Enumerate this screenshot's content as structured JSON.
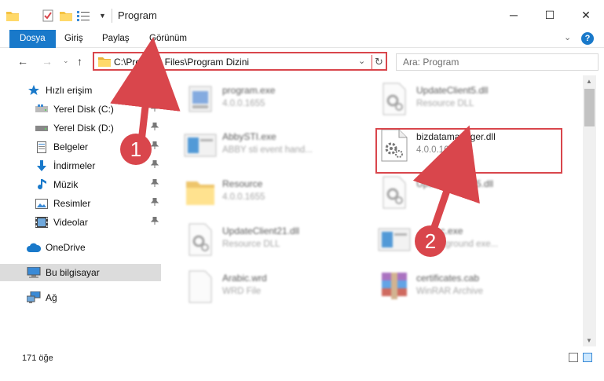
{
  "window": {
    "title": "Program",
    "minimize_glyph": "─",
    "maximize_glyph": "☐",
    "close_glyph": "✕"
  },
  "ribbon": {
    "tabs": [
      {
        "label": "Dosya"
      },
      {
        "label": "Giriş"
      },
      {
        "label": "Paylaş"
      },
      {
        "label": "Görünüm"
      }
    ],
    "help_glyph": "?",
    "collapse_glyph": "⌄"
  },
  "nav": {
    "back_glyph": "←",
    "forward_glyph": "→",
    "recent_glyph": "⌄",
    "up_glyph": "↑",
    "address": "C:\\Program Files\\Program Dizini",
    "address_dropdown_glyph": "⌄",
    "refresh_glyph": "↻",
    "search_placeholder": "Ara: Program"
  },
  "sidebar": {
    "items": [
      {
        "label": "Hızlı erişim",
        "icon": "star-icon"
      },
      {
        "label": "Yerel Disk (C:)",
        "icon": "drive-icon"
      },
      {
        "label": "Yerel Disk (D:)",
        "icon": "drive-icon"
      },
      {
        "label": "Belgeler",
        "icon": "documents-icon"
      },
      {
        "label": "İndirmeler",
        "icon": "download-icon"
      },
      {
        "label": "Müzik",
        "icon": "music-icon"
      },
      {
        "label": "Resimler",
        "icon": "pictures-icon"
      },
      {
        "label": "Videolar",
        "icon": "videos-icon"
      },
      {
        "label": "OneDrive",
        "icon": "cloud-icon"
      },
      {
        "label": "Bu bilgisayar",
        "icon": "computer-icon"
      },
      {
        "label": "Ağ",
        "icon": "network-icon"
      }
    ],
    "pin_glyph": "📌"
  },
  "files": [
    {
      "name": "program.exe",
      "desc": "4.0.0.1655"
    },
    {
      "name": "UpdateClient5.dll",
      "desc": "Resource DLL"
    },
    {
      "name": "AbbySTI.exe",
      "desc": "ABBY sti event hand..."
    },
    {
      "name": "bizdatamanager.dll",
      "desc": "4.0.0.1655"
    },
    {
      "name": "Resource",
      "desc": "4.0.0.1655"
    },
    {
      "name": "UpdateClient65.dll",
      "desc": ""
    },
    {
      "name": "UpdateClient21.dll",
      "desc": "Resource DLL"
    },
    {
      "name": "...Exec.exe",
      "desc": "... background exe..."
    },
    {
      "name": "Arabic.wrd",
      "desc": "WRD File"
    },
    {
      "name": "certificates.cab",
      "desc": "WinRAR Archive"
    }
  ],
  "status": {
    "count": "171 öğe"
  },
  "annotations": {
    "step1": "1",
    "step2": "2",
    "color": "#d9464c"
  }
}
